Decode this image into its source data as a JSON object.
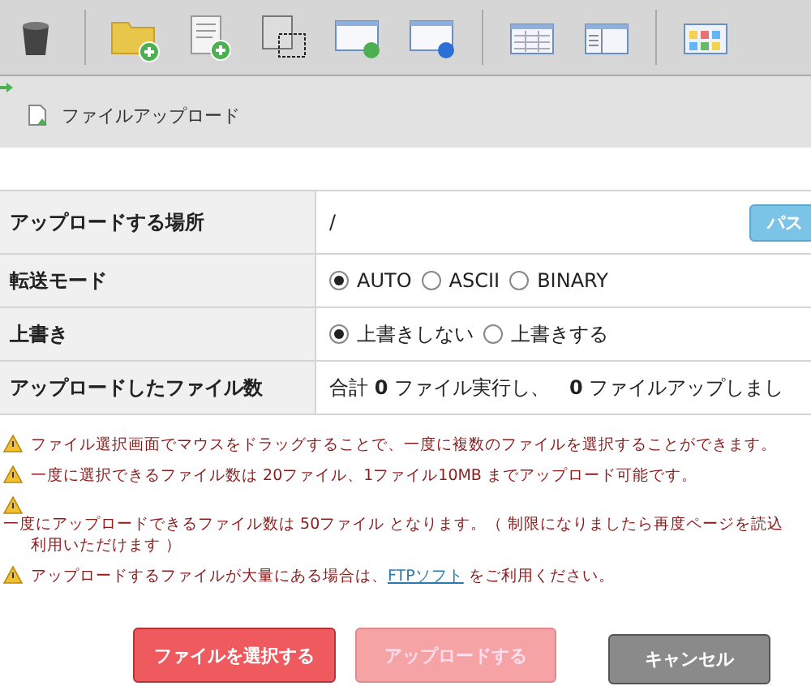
{
  "toolbar": {
    "groups": [
      [
        {
          "kind": "trash"
        }
      ],
      [
        {
          "kind": "folder-add"
        },
        {
          "kind": "file-add"
        },
        {
          "kind": "copy"
        },
        {
          "kind": "window-refresh"
        },
        {
          "kind": "window-globe"
        }
      ],
      [
        {
          "kind": "table"
        },
        {
          "kind": "panel"
        }
      ],
      [
        {
          "kind": "tiles"
        }
      ]
    ]
  },
  "breadcrumb": {
    "title": "ファイルアップロード"
  },
  "form": {
    "rows": [
      {
        "kind": "path",
        "label": "アップロードする場所",
        "value": "/",
        "button": "パス"
      },
      {
        "kind": "radio",
        "label": "転送モード",
        "options": [
          {
            "label": "AUTO",
            "selected": true
          },
          {
            "label": "ASCII",
            "selected": false
          },
          {
            "label": "BINARY",
            "selected": false
          }
        ]
      },
      {
        "kind": "radio",
        "label": "上書き",
        "options": [
          {
            "label": "上書きしない",
            "selected": true
          },
          {
            "label": "上書きする",
            "selected": false
          }
        ]
      },
      {
        "kind": "count",
        "label": "アップロードしたファイル数",
        "value": "合計 **0** ファイル実行し、　**0** ファイルアップしまし"
      }
    ]
  },
  "notices": [
    {
      "text": "ファイル選択画面でマウスをドラッグすることで、一度に複数のファイルを選択することができます。"
    },
    {
      "text": "一度に選択できるファイル数は 20ファイル、1ファイル10MB までアップロード可能です。"
    },
    {
      "text": "一度にアップロードできるファイル数は 50ファイル となります。（ 制限になりましたら再度ページを読込",
      "continuation": "利用いただけます ）"
    },
    {
      "text": "アップロードするファイルが大量にある場合は、",
      "link": "FTPソフト",
      "after": " をご利用ください。"
    }
  ],
  "buttons": [
    {
      "label": "ファイルを選択する",
      "kind": "primary"
    },
    {
      "label": "アップロードする",
      "kind": "disabled"
    },
    {
      "label": "キャンセル",
      "kind": "cancel"
    }
  ]
}
